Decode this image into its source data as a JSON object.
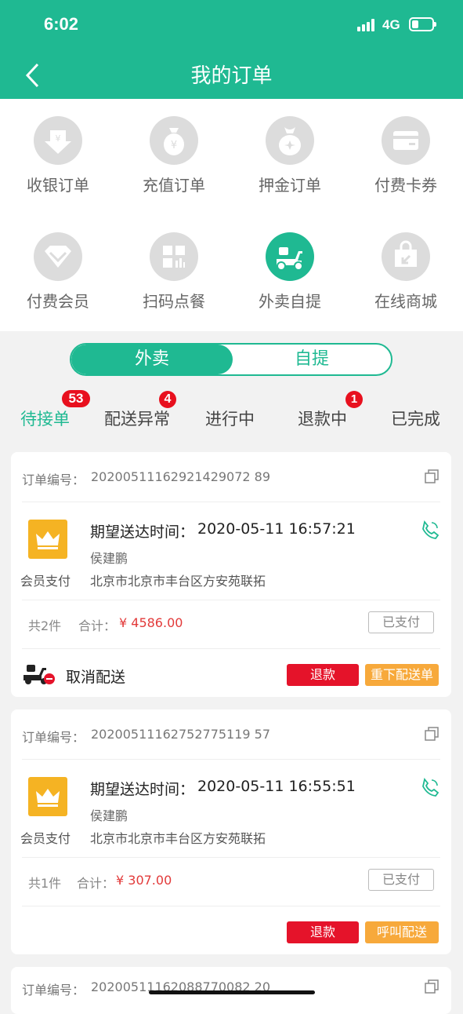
{
  "status_bar": {
    "time": "6:02",
    "network": "4G"
  },
  "header": {
    "title": "我的订单"
  },
  "menu": [
    {
      "label": "收银订单",
      "icon": "download-arrow-icon"
    },
    {
      "label": "充值订单",
      "icon": "money-bag-icon"
    },
    {
      "label": "押金订单",
      "icon": "deposit-bag-icon"
    },
    {
      "label": "付费卡券",
      "icon": "card-icon"
    },
    {
      "label": "付费会员",
      "icon": "member-icon"
    },
    {
      "label": "扫码点餐",
      "icon": "qr-scan-icon"
    },
    {
      "label": "外卖自提",
      "icon": "scooter-icon",
      "active": true
    },
    {
      "label": "在线商城",
      "icon": "mall-bag-icon"
    }
  ],
  "segment": {
    "left": "外卖",
    "right": "自提",
    "selected": "外卖"
  },
  "tabs": [
    {
      "label": "待接单",
      "badge": "53",
      "active": true
    },
    {
      "label": "配送异常",
      "badge": "4"
    },
    {
      "label": "进行中"
    },
    {
      "label": "退款中",
      "badge": "1"
    },
    {
      "label": "已完成"
    }
  ],
  "orders": [
    {
      "order_label": "订单编号：",
      "order_no": "20200511162921429072 89",
      "pay_method": "会员支付",
      "expect_label": "期望送达时间：",
      "expect_time": "2020-05-11 16:57:21",
      "customer": "侯建鹏",
      "address": "北京市北京市丰台区方安苑联拓",
      "count": "共2件",
      "total_label": "合计：",
      "total": "¥ 4586.00",
      "status": "已支付",
      "delivery_status": "取消配送",
      "btn_refund": "退款",
      "btn_action": "重下配送单"
    },
    {
      "order_label": "订单编号：",
      "order_no": "20200511162752775119 57",
      "pay_method": "会员支付",
      "expect_label": "期望送达时间：",
      "expect_time": "2020-05-11 16:55:51",
      "customer": "侯建鹏",
      "address": "北京市北京市丰台区方安苑联拓",
      "count": "共1件",
      "total_label": "合计：",
      "total": "¥ 307.00",
      "status": "已支付",
      "btn_refund": "退款",
      "btn_action": "呼叫配送"
    },
    {
      "order_label": "订单编号：",
      "order_no": "20200511162088770082 20"
    }
  ],
  "colors": {
    "primary": "#1fb992",
    "danger": "#e5132a",
    "warning": "#f7a93b",
    "crown": "#f5b323"
  }
}
